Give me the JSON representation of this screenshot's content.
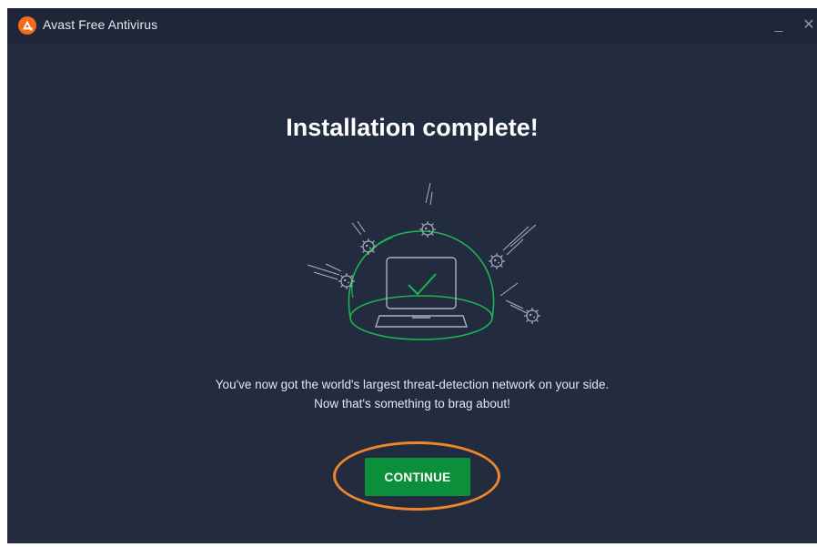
{
  "window": {
    "title": "Avast Free Antivirus",
    "minimize_label": "_",
    "close_label": "✕"
  },
  "main": {
    "heading": "Installation complete!",
    "message_line1": "You've now got the world's largest threat-detection network on your side.",
    "message_line2": "Now that's something to brag about!",
    "continue_label": "CONTINUE"
  },
  "colors": {
    "background": "#232b3e",
    "titlebar": "#1f2638",
    "accent_green": "#0b8f3b",
    "dome_green": "#1fb452",
    "logo_orange": "#f26b1d",
    "highlight_orange": "#f0862a"
  },
  "icons": {
    "logo": "avast-logo-icon",
    "illustration": "laptop-shield-dome-icon",
    "check": "checkmark-icon",
    "threats": "virus-icon"
  }
}
